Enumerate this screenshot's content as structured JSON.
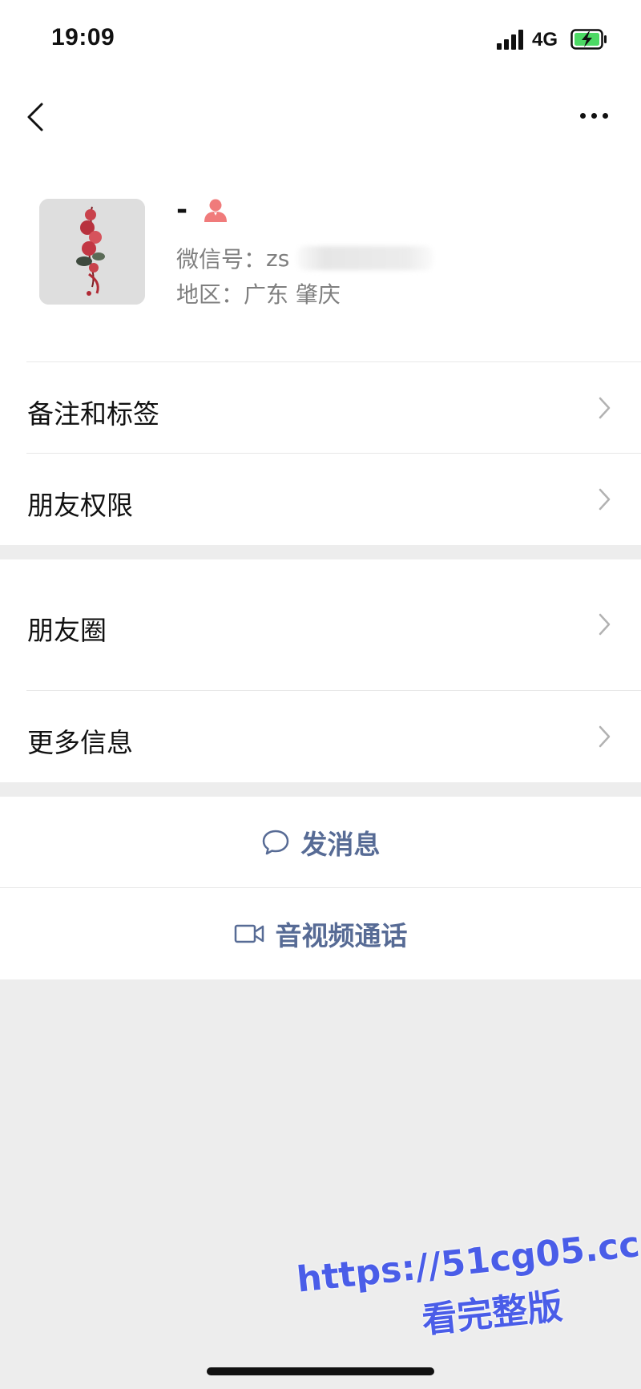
{
  "status_bar": {
    "time": "19:09",
    "network": "4G"
  },
  "profile": {
    "nickname": "-",
    "wechat_id_label": "微信号：",
    "wechat_id_visible": "zs",
    "region_label": "地区：",
    "region_value": "广东 肇庆"
  },
  "menu": {
    "remark_tags": "备注和标签",
    "friend_permissions": "朋友权限",
    "moments": "朋友圈",
    "more_info": "更多信息"
  },
  "actions": {
    "send_message": "发消息",
    "av_call": "音视频通话"
  },
  "watermark": {
    "url": "https://51cg05.cc",
    "text": "看完整版"
  },
  "colors": {
    "link_blue": "#576b95",
    "background_gray": "#ededed",
    "gender_female": "#f07b7b",
    "watermark_blue": "#4a5de8"
  }
}
